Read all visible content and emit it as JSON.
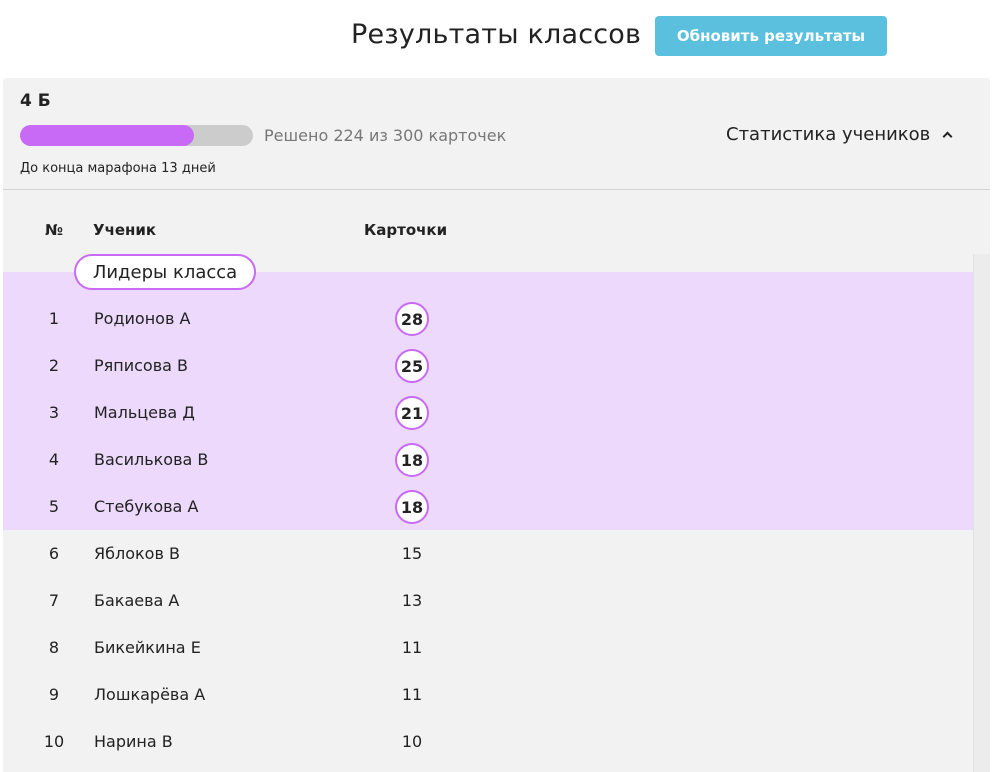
{
  "header": {
    "title": "Результаты классов",
    "refresh_label": "Обновить результаты"
  },
  "class_panel": {
    "class_name": "4 Б",
    "progress": {
      "solved": 224,
      "total": 300,
      "fraction": 0.7467
    },
    "progress_text": "Решено 224 из 300 карточек",
    "deadline_text": "До конца марафона 13 дней",
    "stats_toggle_label": "Статистика учеников"
  },
  "table": {
    "columns": {
      "num": "№",
      "student": "Ученик",
      "cards": "Карточки"
    },
    "leaders_label": "Лидеры класса",
    "rows": [
      {
        "num": "1",
        "name": "Родионов А",
        "cards": "28",
        "leader": true
      },
      {
        "num": "2",
        "name": "Ряписова В",
        "cards": "25",
        "leader": true
      },
      {
        "num": "3",
        "name": "Мальцева Д",
        "cards": "21",
        "leader": true
      },
      {
        "num": "4",
        "name": "Василькова В",
        "cards": "18",
        "leader": true
      },
      {
        "num": "5",
        "name": "Стебукова А",
        "cards": "18",
        "leader": true
      },
      {
        "num": "6",
        "name": "Яблоков В",
        "cards": "15",
        "leader": false
      },
      {
        "num": "7",
        "name": "Бакаева А",
        "cards": "13",
        "leader": false
      },
      {
        "num": "8",
        "name": "Бикейкина Е",
        "cards": "11",
        "leader": false
      },
      {
        "num": "9",
        "name": "Лошкарёва А",
        "cards": "11",
        "leader": false
      },
      {
        "num": "10",
        "name": "Нарина В",
        "cards": "10",
        "leader": false
      }
    ]
  },
  "colors": {
    "accent": "#c86af5",
    "leaders_background": "#ecd9fb",
    "button": "#5bc0de",
    "panel": "#f2f2f2"
  }
}
